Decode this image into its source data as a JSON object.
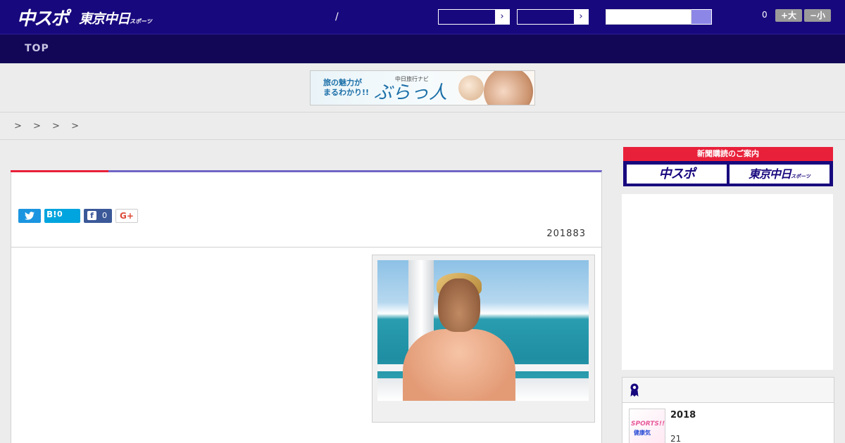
{
  "header": {
    "logo_main": "中スポ",
    "logo_sub": "東京中日",
    "logo_sub_small": "スポーツ",
    "separator": "/",
    "dropdown_arrow": "›",
    "counter": "0",
    "font_large_label": "+大",
    "font_small_label": "−小"
  },
  "nav": {
    "top_label": "TOP"
  },
  "banner": {
    "line1": "旅の魅力が",
    "line2": "まるわかり!!",
    "tag": "中日旅行ナビ",
    "logo": "ぶらっ人"
  },
  "breadcrumb": {
    "text": "> > > >"
  },
  "article": {
    "share": {
      "twitter_icon": "bird-icon",
      "hatena_label": "B!",
      "hatena_count": "0",
      "facebook_label": "f",
      "facebook_count": "0",
      "gplus_label": "G+"
    },
    "date": "201883"
  },
  "sidebar": {
    "subscribe_header": "新聞購読のご案内",
    "subscribe_btn1": "中スポ",
    "subscribe_btn2": "東京中日",
    "subscribe_btn2_small": "スポーツ",
    "ranking": {
      "item_title": "2018",
      "item_sub": "21",
      "thumb_text1": "SPORTS!!",
      "thumb_text2": "健康気"
    }
  },
  "colors": {
    "header_bg": "#18087e",
    "nav_bg": "#120657",
    "accent_red": "#e9203a",
    "accent_purple": "#7065c6",
    "search_button": "#8c86e6"
  }
}
